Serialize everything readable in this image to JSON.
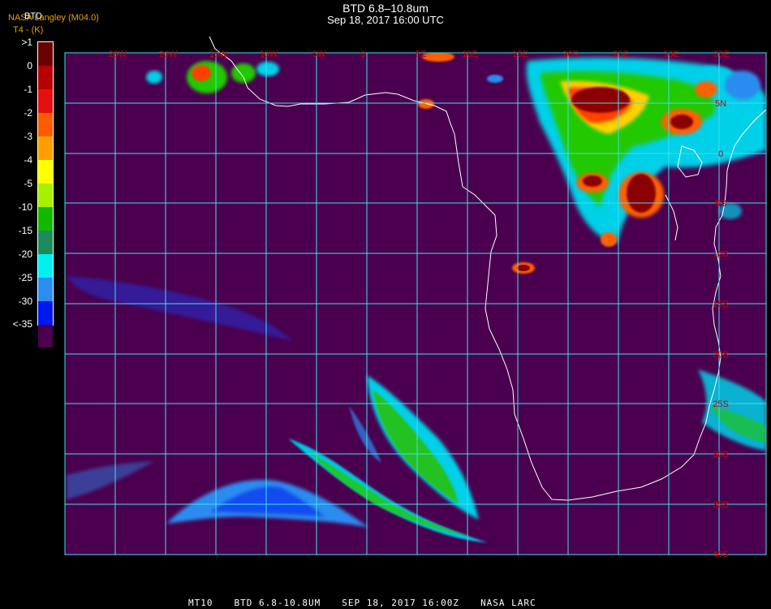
{
  "header": {
    "title": "BTD 6.8–10.8um",
    "subtitle": "Sep 18, 2017 16:00 UTC",
    "credit": "NASA Langley (M04.0)",
    "units": "T4 - (K)",
    "product_tag": "BTD"
  },
  "legend": {
    "labels": [
      ">1",
      "0",
      "-1",
      "-2",
      "-3",
      "-4",
      "-5",
      "-10",
      "-15",
      "-20",
      "-25",
      "-30",
      "<-35"
    ],
    "colors": [
      "#6b0000",
      "#b80000",
      "#e41010",
      "#ff5a00",
      "#ff9e00",
      "#ffff00",
      "#a6f000",
      "#12b800",
      "#1c8a5a",
      "#00f0f0",
      "#2c8cf0",
      "#0018f0",
      "#4a004f"
    ]
  },
  "grid": {
    "lon_labels": [
      "25W",
      "20W",
      "15W",
      "10W",
      "5W",
      "0",
      "5E",
      "10E",
      "15E",
      "20E",
      "25E",
      "30E",
      "35E"
    ],
    "lat_labels": [
      "5N",
      "0",
      "5S",
      "10S",
      "15S",
      "20S",
      "25S",
      "30S",
      "35S",
      "40S"
    ]
  },
  "footer": {
    "sat": "MT10",
    "product": "BTD 6.8-10.8UM",
    "datetime": "SEP 18, 2017 16:00Z",
    "org": "NASA LARC"
  },
  "colors": {
    "background": "#4a004f",
    "grid": "#40e0f0",
    "labels": "#c80000"
  }
}
